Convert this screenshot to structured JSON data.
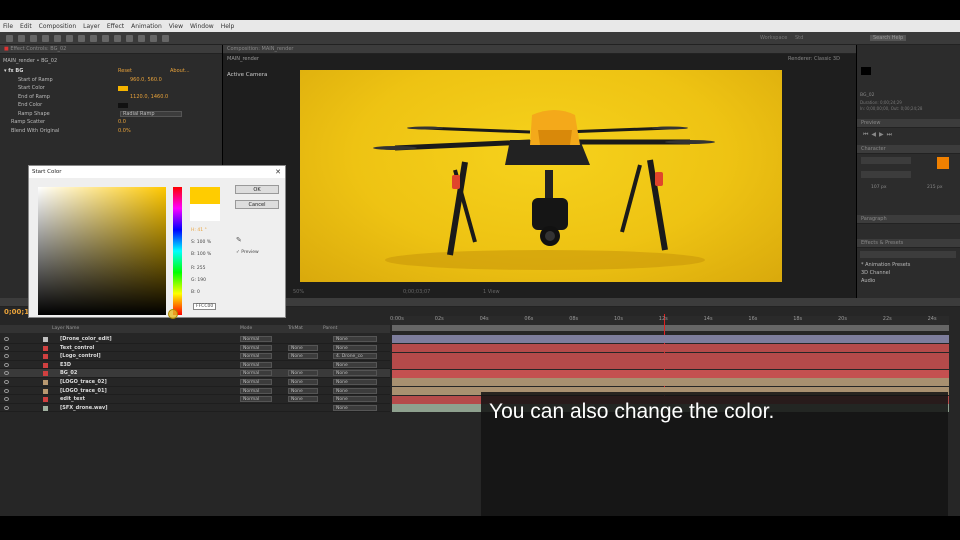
{
  "menu": [
    "File",
    "Edit",
    "Composition",
    "Layer",
    "Effect",
    "Animation",
    "View",
    "Window",
    "Help"
  ],
  "toolbar": {
    "workspace": "Workspace",
    "workspace_value": "Std",
    "search": "Search Help"
  },
  "effect_controls": {
    "tab": "Effect Controls: BG_02",
    "breadcrumb": "MAIN_render • BG_02",
    "effect_name": "BG",
    "reset": "Reset",
    "about": "About...",
    "rows": [
      {
        "name": "Start of Ramp",
        "value": "960.0, 560.0"
      },
      {
        "name": "Start Color",
        "value": ""
      },
      {
        "name": "End of Ramp",
        "value": "1120.0, 1460.0"
      },
      {
        "name": "End Color",
        "value": ""
      },
      {
        "name": "Ramp Shape",
        "value": "Radial Ramp"
      },
      {
        "name": "Ramp Scatter",
        "value": "0.0"
      },
      {
        "name": "Blend With Original",
        "value": "0.0%"
      }
    ],
    "start_color": "#f5b400",
    "end_color": "#111111"
  },
  "color_dialog": {
    "title": "Start Color",
    "ok": "OK",
    "cancel": "Cancel",
    "preview": "Preview",
    "h": "H: 41 °",
    "s": "S: 100 %",
    "b": "B: 100 %",
    "r": "R: 255",
    "g": "G: 190",
    "bl": "B: 0",
    "hex": "FFCC00",
    "current_color": "#ffcc00"
  },
  "composition": {
    "tab": "Composition: MAIN_render",
    "sub_tab": "MAIN_render",
    "view_label": "Active Camera",
    "renderer": "Renderer:",
    "renderer_value": "Classic 3D",
    "zoom": "50%",
    "time": "0;00;03;07",
    "view_mode": "1 View"
  },
  "right_panels": {
    "preview_tab": "Preview",
    "character_tab": "Character",
    "paragraph_tab": "Paragraph",
    "effects_tab": "Effects & Presets",
    "info_title": "BG_02",
    "info_line1": "Duration: 0;00;24;29",
    "info_line2": "In: 0;00;00;00, Out: 0;00;24;28",
    "font_size": "107 px",
    "tracking": "215 px",
    "presets": [
      "* Animation Presets",
      "3D Channel",
      "Audio"
    ],
    "accent_color": "#f08000"
  },
  "timeline": {
    "current_time": "0;00;13",
    "headers": {
      "layer_name": "Layer Name",
      "mode": "Mode",
      "trkmat": "TrkMat",
      "parent": "Parent"
    },
    "ticks": [
      "0:00s",
      "02s",
      "04s",
      "06s",
      "08s",
      "10s",
      "12s",
      "14s",
      "16s",
      "18s",
      "20s",
      "22s",
      "24s"
    ],
    "layers": [
      {
        "num": "1",
        "name": "[Drone_color_edit]",
        "color": "#c0c0c0",
        "mode": "Normal",
        "trk": "",
        "parent": "None",
        "bar": "#7d7d9c"
      },
      {
        "num": "2",
        "name": "Text_control",
        "color": "#d04040",
        "mode": "Normal",
        "trk": "None",
        "parent": "None",
        "bar": "#b54a4a"
      },
      {
        "num": "3",
        "name": "[Logo_control]",
        "color": "#d04040",
        "mode": "Normal",
        "trk": "None",
        "parent": "4. Drone_co",
        "bar": "#b54a4a"
      },
      {
        "num": "4",
        "name": "E3D",
        "color": "#d04040",
        "mode": "Normal",
        "trk": "",
        "parent": "None",
        "bar": "#b54a4a"
      },
      {
        "num": "5",
        "name": "BG_02",
        "color": "#d04040",
        "mode": "Normal",
        "trk": "None",
        "parent": "None",
        "bar": "#c45050"
      },
      {
        "num": "6",
        "name": "[LOGO_trace_02]",
        "color": "#b89870",
        "mode": "Normal",
        "trk": "None",
        "parent": "None",
        "bar": "#a89070"
      },
      {
        "num": "7",
        "name": "[LOGO_trace_01]",
        "color": "#b89870",
        "mode": "Normal",
        "trk": "None",
        "parent": "None",
        "bar": "#a89070"
      },
      {
        "num": "8",
        "name": "edit_text",
        "color": "#d04040",
        "mode": "Normal",
        "trk": "None",
        "parent": "None",
        "bar": "#b54a4a"
      },
      {
        "num": "9",
        "name": "[SFX_drone.wav]",
        "color": "#a0b0a0",
        "mode": "",
        "trk": "",
        "parent": "None",
        "bar": "#8ea08e"
      }
    ]
  },
  "caption": "You can also change the color."
}
